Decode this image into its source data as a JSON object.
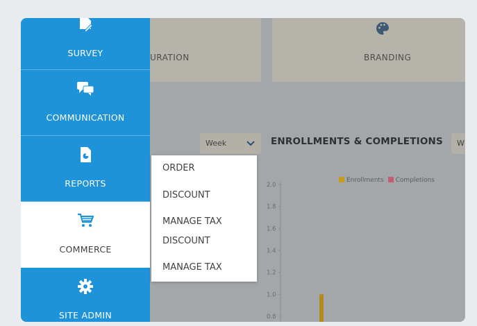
{
  "cards": {
    "configuration_label": "URATION",
    "branding_label": "BRANDING"
  },
  "filter": {
    "week_label": "Week",
    "week_label_2": "W"
  },
  "chart": {
    "title": "ENROLLMENTS & COMPLETIONS",
    "legend": [
      "Enrollments",
      "Completions"
    ],
    "colors": {
      "enrollments": "#d3a21a",
      "completions": "#d2667e"
    }
  },
  "chart_data": {
    "type": "bar",
    "title": "ENROLLMENTS & COMPLETIONS",
    "xlabel": "",
    "ylabel": "",
    "ylim": [
      0.8,
      2.0
    ],
    "y_ticks": [
      "2.0",
      "1.8",
      "1.6",
      "1.4",
      "1.2",
      "1.0",
      "0.8"
    ],
    "series": [
      {
        "name": "Enrollments",
        "values": [
          1.0
        ]
      },
      {
        "name": "Completions",
        "values": []
      }
    ]
  },
  "sidebar": {
    "items": [
      {
        "label": "SURVEY",
        "icon": "survey-icon"
      },
      {
        "label": "COMMUNICATION",
        "icon": "chat-icon"
      },
      {
        "label": "REPORTS",
        "icon": "reports-icon"
      },
      {
        "label": "COMMERCE",
        "icon": "cart-icon",
        "active": true
      },
      {
        "label": "SITE ADMIN",
        "icon": "gear-icon"
      }
    ],
    "accent": "#1f93da"
  },
  "commerce_menu": {
    "items": [
      "ORDER",
      "DISCOUNT",
      "MANAGE TAX",
      "DISCOUNT",
      "MANAGE TAX"
    ]
  }
}
